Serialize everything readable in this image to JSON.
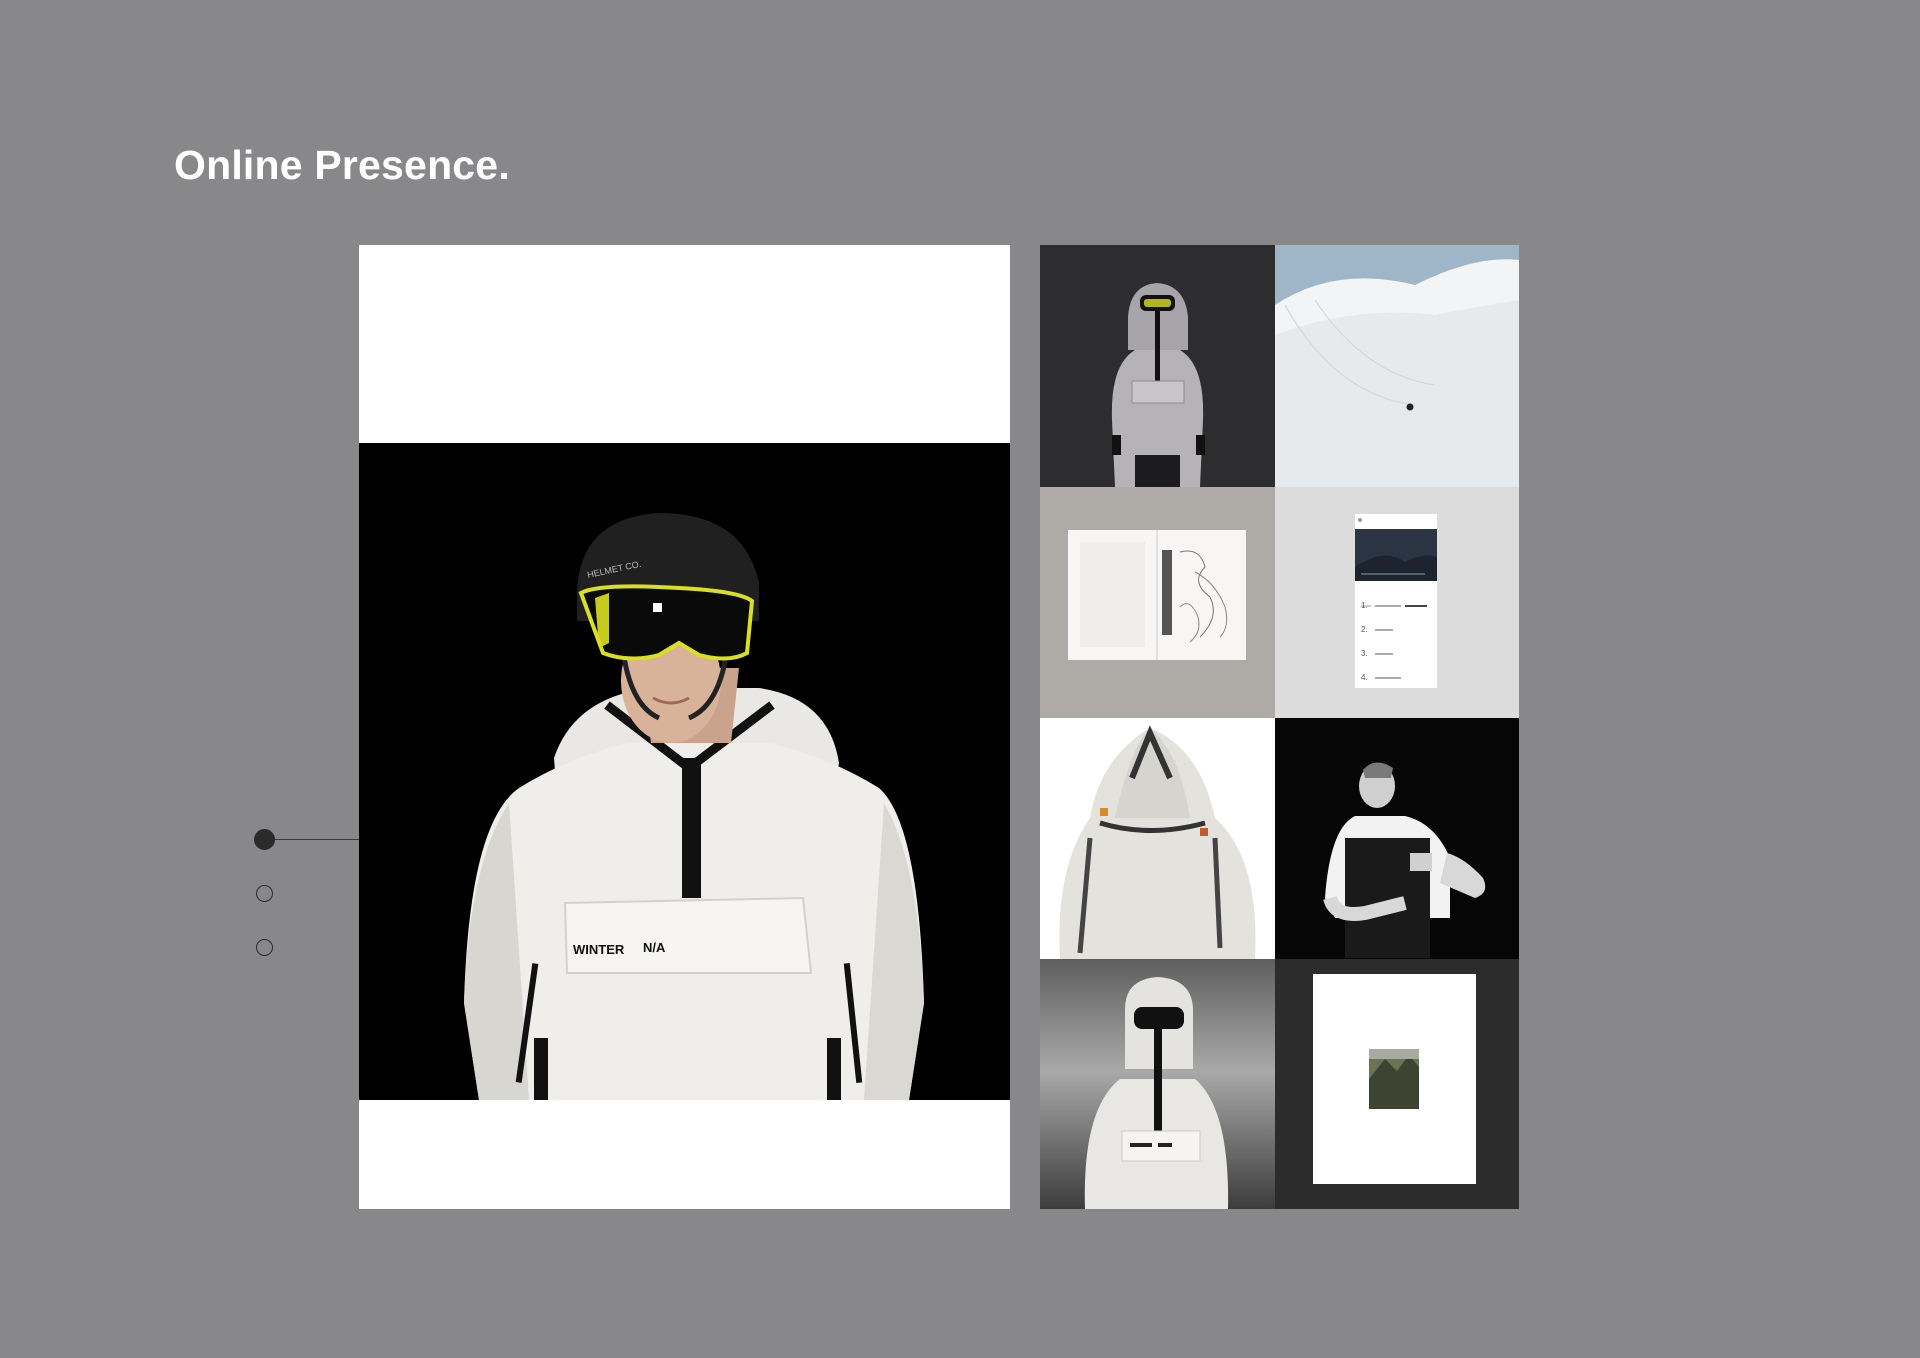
{
  "page": {
    "title": "Online Presence."
  },
  "hero": {
    "chest_label": "WINTER",
    "chest_code": "N/A",
    "helmet_label": "HELMET CO."
  },
  "pagination": {
    "total": 3,
    "active_index": 0
  },
  "gallery": {
    "tiles": [
      {
        "name": "model-grey-anorak"
      },
      {
        "name": "snow-slope"
      },
      {
        "name": "sketchbook"
      },
      {
        "name": "phone-list-screen"
      },
      {
        "name": "hood-back-view"
      },
      {
        "name": "man-adjusting-overalls"
      },
      {
        "name": "model-white-anorak-sky"
      },
      {
        "name": "framed-mountain-print"
      }
    ],
    "phone_list": [
      {
        "num": "1."
      },
      {
        "num": "2."
      },
      {
        "num": "3."
      },
      {
        "num": "4."
      }
    ]
  },
  "colors": {
    "background": "#88888a",
    "card": "#ffffff",
    "photo_bg": "#000000",
    "goggle_accent": "#d9e021"
  }
}
